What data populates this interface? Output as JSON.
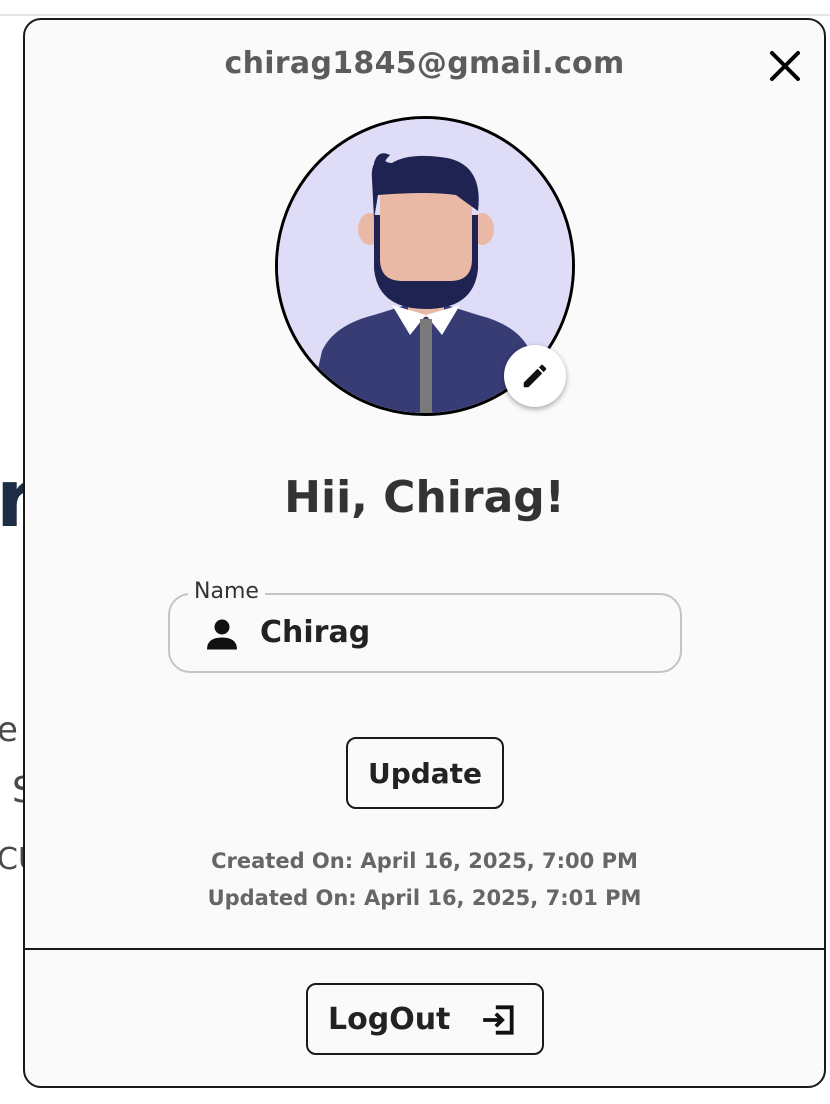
{
  "background": {
    "frag_r": "r",
    "frag_e": "e",
    "frag_s": "S",
    "frag_cu": "CU"
  },
  "modal": {
    "email": "chirag1845@gmail.com",
    "close_icon": "close-icon",
    "avatar_icon": "user-avatar-illustration",
    "edit_icon": "pencil-icon",
    "greeting": "Hii, Chirag!",
    "name_field": {
      "label": "Name",
      "value": "Chirag",
      "icon": "person-icon"
    },
    "update_label": "Update",
    "created_on": "Created On: April 16, 2025, 7:00 PM",
    "updated_on": "Updated On: April 16, 2025, 7:01 PM",
    "logout_label": "LogOut",
    "logout_icon": "logout-icon"
  },
  "colors": {
    "avatar_bg": "#dedcf7",
    "hair": "#1e2352",
    "skin": "#e9b9a5",
    "shirt": "#373c75",
    "text_dark": "#333333",
    "text_muted": "#666666"
  }
}
